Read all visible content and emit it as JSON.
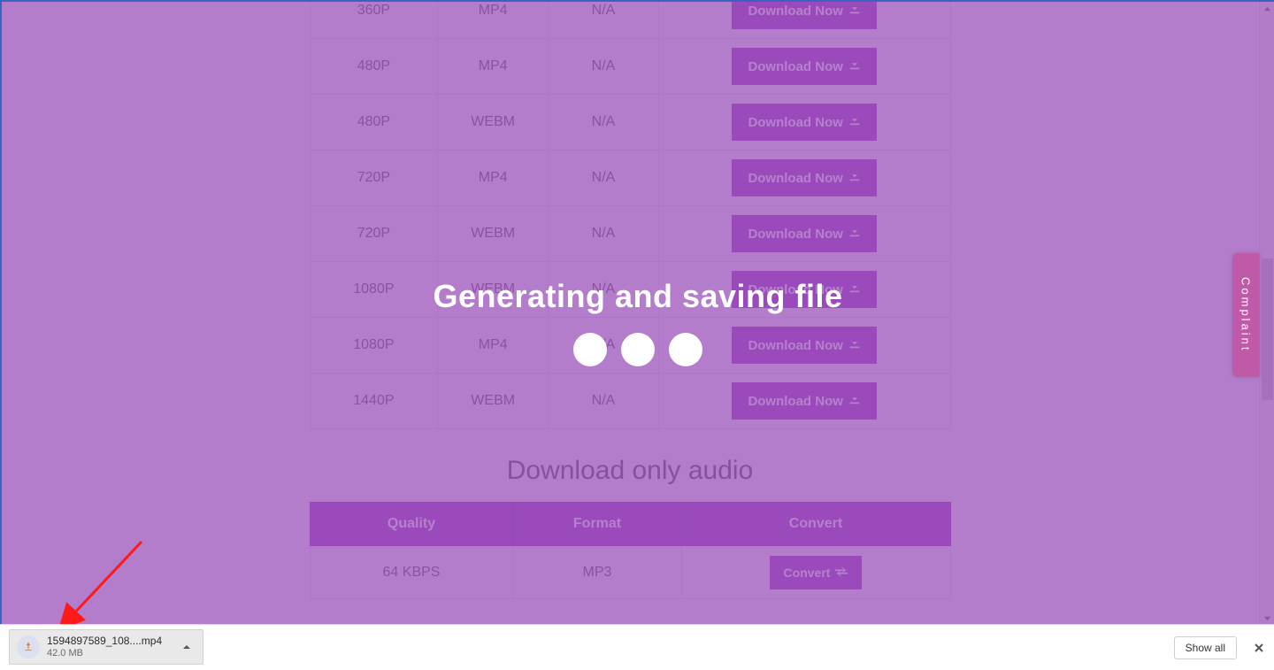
{
  "overlay": {
    "message": "Generating and saving file"
  },
  "video_rows": [
    {
      "quality": "360P",
      "format": "MP4",
      "size": "N/A",
      "button": "Download Now"
    },
    {
      "quality": "480P",
      "format": "MP4",
      "size": "N/A",
      "button": "Download Now"
    },
    {
      "quality": "480P",
      "format": "WEBM",
      "size": "N/A",
      "button": "Download Now"
    },
    {
      "quality": "720P",
      "format": "MP4",
      "size": "N/A",
      "button": "Download Now"
    },
    {
      "quality": "720P",
      "format": "WEBM",
      "size": "N/A",
      "button": "Download Now"
    },
    {
      "quality": "1080P",
      "format": "WEBM",
      "size": "N/A",
      "button": "Download Now"
    },
    {
      "quality": "1080P",
      "format": "MP4",
      "size": "N/A",
      "button": "Download Now"
    },
    {
      "quality": "1440P",
      "format": "WEBM",
      "size": "N/A",
      "button": "Download Now"
    }
  ],
  "audio_section": {
    "heading": "Download only audio",
    "columns": {
      "quality": "Quality",
      "format": "Format",
      "convert": "Convert"
    },
    "rows": [
      {
        "quality": "64 KBPS",
        "format": "MP3",
        "button": "Convert"
      }
    ]
  },
  "complaint_tab": "Complaint",
  "download_bar": {
    "file_name": "1594897589_108....mp4",
    "file_size": "42.0 MB",
    "show_all": "Show all"
  },
  "colors": {
    "accent": "#9b3fbf",
    "overlay": "rgba(154,79,186,0.72)",
    "complaint": "#c059a7"
  }
}
